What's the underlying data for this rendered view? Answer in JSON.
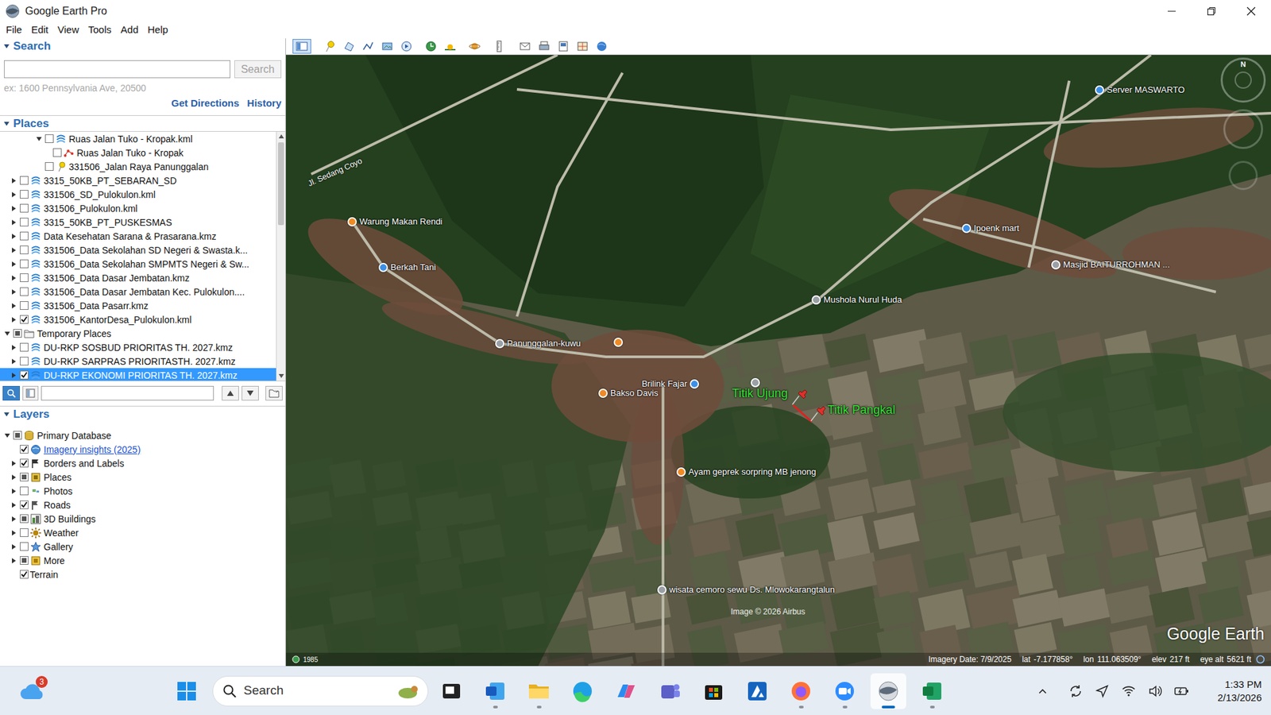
{
  "window": {
    "title": "Google Earth Pro"
  },
  "menu": [
    "File",
    "Edit",
    "View",
    "Tools",
    "Add",
    "Help"
  ],
  "search": {
    "header": "Search",
    "expanded": true,
    "value": "",
    "button": "Search",
    "button_disabled": true,
    "hint": "ex: 1600 Pennsylvania Ave, 20500",
    "links": [
      "Get Directions",
      "History"
    ]
  },
  "places": {
    "header": "Places",
    "expanded": true,
    "scrollbar": {
      "level": 0.36
    },
    "items": [
      {
        "label": "Ruas Jalan Tuko - Kropak.kml",
        "depth": 2,
        "expandable": true,
        "expanded": true,
        "checked": false,
        "partial": false,
        "icon": "kml",
        "selected": false,
        "link": false
      },
      {
        "label": "Ruas Jalan Tuko - Kropak",
        "depth": 3,
        "expandable": false,
        "expanded": false,
        "checked": false,
        "partial": false,
        "icon": "path",
        "selected": false,
        "link": false
      },
      {
        "label": "331506_Jalan Raya Panunggalan",
        "depth": 2,
        "expandable": false,
        "expanded": false,
        "checked": false,
        "partial": false,
        "icon": "pin",
        "selected": false,
        "link": false
      },
      {
        "label": "3315_50KB_PT_SEBARAN_SD",
        "depth": 1,
        "expandable": true,
        "expanded": false,
        "checked": false,
        "partial": false,
        "icon": "kml",
        "selected": false,
        "link": false
      },
      {
        "label": "331506_SD_Pulokulon.kml",
        "depth": 1,
        "expandable": true,
        "expanded": false,
        "checked": false,
        "partial": false,
        "icon": "kml",
        "selected": false,
        "link": false
      },
      {
        "label": "331506_Pulokulon.kml",
        "depth": 1,
        "expandable": true,
        "expanded": false,
        "checked": false,
        "partial": false,
        "icon": "kml",
        "selected": false,
        "link": false
      },
      {
        "label": "3315_50KB_PT_PUSKESMAS",
        "depth": 1,
        "expandable": true,
        "expanded": false,
        "checked": false,
        "partial": false,
        "icon": "kml",
        "selected": false,
        "link": false
      },
      {
        "label": "Data Kesehatan Sarana & Prasarana.kmz",
        "depth": 1,
        "expandable": true,
        "expanded": false,
        "checked": false,
        "partial": false,
        "icon": "kml",
        "selected": false,
        "link": false
      },
      {
        "label": "331506_Data Sekolahan SD Negeri & Swasta.k...",
        "depth": 1,
        "expandable": true,
        "expanded": false,
        "checked": false,
        "partial": false,
        "icon": "kml",
        "selected": false,
        "link": false
      },
      {
        "label": "331506_Data Sekolahan SMPMTS Negeri & Sw...",
        "depth": 1,
        "expandable": true,
        "expanded": false,
        "checked": false,
        "partial": false,
        "icon": "kml",
        "selected": false,
        "link": false
      },
      {
        "label": "331506_Data Dasar Jembatan.kmz",
        "depth": 1,
        "expandable": true,
        "expanded": false,
        "checked": false,
        "partial": false,
        "icon": "kml",
        "selected": false,
        "link": false
      },
      {
        "label": "331506_Data Dasar Jembatan Kec. Pulokulon....",
        "depth": 1,
        "expandable": true,
        "expanded": false,
        "checked": false,
        "partial": false,
        "icon": "kml",
        "selected": false,
        "link": false
      },
      {
        "label": "331506_Data Pasarr.kmz",
        "depth": 1,
        "expandable": true,
        "expanded": false,
        "checked": false,
        "partial": false,
        "icon": "kml",
        "selected": false,
        "link": false
      },
      {
        "label": "331506_KantorDesa_Pulokulon.kml",
        "depth": 1,
        "expandable": true,
        "expanded": false,
        "checked": true,
        "partial": false,
        "icon": "kml",
        "selected": false,
        "link": false
      },
      {
        "label": "Temporary Places",
        "depth": 0,
        "expandable": true,
        "expanded": true,
        "checked": false,
        "partial": true,
        "icon": "folder",
        "selected": false,
        "link": false
      },
      {
        "label": "DU-RKP SOSBUD PRIORITAS TH. 2027.kmz",
        "depth": 1,
        "expandable": true,
        "expanded": false,
        "checked": false,
        "partial": false,
        "icon": "kml",
        "selected": false,
        "link": false
      },
      {
        "label": "DU-RKP SARPRAS PRIORITASTH. 2027.kmz",
        "depth": 1,
        "expandable": true,
        "expanded": false,
        "checked": false,
        "partial": false,
        "icon": "kml",
        "selected": false,
        "link": false
      },
      {
        "label": "DU-RKP EKONOMI PRIORITAS TH. 2027.kmz",
        "depth": 1,
        "expandable": true,
        "expanded": false,
        "checked": true,
        "partial": false,
        "icon": "kml",
        "selected": true,
        "link": false
      }
    ],
    "filter": {
      "value": "",
      "search_pressed": true
    }
  },
  "layers": {
    "header": "Layers",
    "expanded": true,
    "items": [
      {
        "label": "Primary Database",
        "depth": 0,
        "expandable": true,
        "expanded": true,
        "checked": false,
        "partial": true,
        "icon": "database",
        "selected": false,
        "link": false
      },
      {
        "label": "Imagery insights (2025)",
        "depth": 1,
        "expandable": false,
        "expanded": false,
        "checked": true,
        "partial": false,
        "icon": "imagery",
        "selected": false,
        "link": true
      },
      {
        "label": "Borders and Labels",
        "depth": 1,
        "expandable": true,
        "expanded": false,
        "checked": true,
        "partial": false,
        "icon": "borders",
        "selected": false,
        "link": false
      },
      {
        "label": "Places",
        "depth": 1,
        "expandable": true,
        "expanded": false,
        "checked": false,
        "partial": true,
        "icon": "places",
        "selected": false,
        "link": false
      },
      {
        "label": "Photos",
        "depth": 1,
        "expandable": true,
        "expanded": false,
        "checked": false,
        "partial": false,
        "icon": "photos",
        "selected": false,
        "link": false
      },
      {
        "label": "Roads",
        "depth": 1,
        "expandable": true,
        "expanded": false,
        "checked": true,
        "partial": false,
        "icon": "roads",
        "selected": false,
        "link": false
      },
      {
        "label": "3D Buildings",
        "depth": 1,
        "expandable": true,
        "expanded": false,
        "checked": false,
        "partial": true,
        "icon": "buildings",
        "selected": false,
        "link": false
      },
      {
        "label": "Weather",
        "depth": 1,
        "expandable": true,
        "expanded": false,
        "checked": false,
        "partial": false,
        "icon": "weather",
        "selected": false,
        "link": false
      },
      {
        "label": "Gallery",
        "depth": 1,
        "expandable": true,
        "expanded": false,
        "checked": false,
        "partial": false,
        "icon": "gallery",
        "selected": false,
        "link": false
      },
      {
        "label": "More",
        "depth": 1,
        "expandable": true,
        "expanded": false,
        "checked": false,
        "partial": true,
        "icon": "more",
        "selected": false,
        "link": false
      },
      {
        "label": "Terrain",
        "depth": 1,
        "expandable": false,
        "expanded": false,
        "checked": true,
        "partial": false,
        "icon": "none",
        "selected": false,
        "link": false
      }
    ]
  },
  "toolbar": {
    "sidebar_pressed": true
  },
  "map": {
    "road_label": "Jl. Sedang Coyo",
    "compass": "N",
    "pins": [
      {
        "label": "Server MASWARTO",
        "kind": "dot",
        "color": "#3d8fe6"
      },
      {
        "label": "Warung Makan Rendi",
        "kind": "dot",
        "color": "#f08a24"
      },
      {
        "label": "Berkah Tani",
        "kind": "dot",
        "color": "#3d8fe6"
      },
      {
        "label": "Ipoenk mart",
        "kind": "dot",
        "color": "#3d8fe6"
      },
      {
        "label": "Masjid BAITURROHMAN ...",
        "kind": "dot",
        "color": "#9aa0a6"
      },
      {
        "label": "Mushola Nurul Huda",
        "kind": "dot",
        "color": "#9aa0a6"
      },
      {
        "label": "Panunggalan-kuwu",
        "kind": "dot",
        "color": "#9aa0a6"
      },
      {
        "label": "",
        "kind": "dot",
        "color": "#f08a24"
      },
      {
        "label": "Brilink Fajar",
        "kind": "dot",
        "color": "#3d8fe6"
      },
      {
        "label": "",
        "kind": "dot",
        "color": "#9aa0a6"
      },
      {
        "label": "Bakso Davis",
        "kind": "dot",
        "color": "#f08a24"
      },
      {
        "label": "Ayam geprek sorpring MB jenong",
        "kind": "dot",
        "color": "#f08a24"
      },
      {
        "label": "wisata cemoro sewu Ds. Mlowokarangtalun",
        "kind": "dot",
        "color": "#9aa0a6"
      },
      {
        "label": "Titik Ujung",
        "kind": "pushpin",
        "color": "#e0302a"
      },
      {
        "label": "Titik Pangkal",
        "kind": "pushpin",
        "color": "#e0302a"
      }
    ],
    "attribution": "Image © 2026 Airbus",
    "logo": "Google Earth",
    "status": {
      "year": "1985",
      "imagery_date": "Imagery Date: 7/9/2025",
      "lat_label": "lat",
      "lat": "-7.177858°",
      "lon_label": "lon",
      "lon": "111.063509°",
      "elev_label": "elev",
      "elev": "217 ft",
      "eye_alt_label": "eye alt",
      "eye_alt": "5621 ft"
    }
  },
  "taskbar": {
    "weather_badge": "3",
    "search": "Search",
    "apps": [
      {
        "kind": "taskview",
        "running": false,
        "active": false
      },
      {
        "kind": "word",
        "running": true,
        "active": false
      },
      {
        "kind": "explorer",
        "running": true,
        "active": false
      },
      {
        "kind": "edge",
        "running": false,
        "active": false
      },
      {
        "kind": "copilot",
        "running": false,
        "active": false
      },
      {
        "kind": "teams",
        "running": false,
        "active": false
      },
      {
        "kind": "store",
        "running": false,
        "active": false
      },
      {
        "kind": "azure",
        "running": false,
        "active": false
      },
      {
        "kind": "firefox",
        "running": true,
        "active": false
      },
      {
        "kind": "zoom",
        "running": true,
        "active": false
      },
      {
        "kind": "earth",
        "running": true,
        "active": true
      },
      {
        "kind": "excel",
        "running": true,
        "active": false
      }
    ],
    "time": "1:33 PM",
    "date": "2/13/2026"
  }
}
